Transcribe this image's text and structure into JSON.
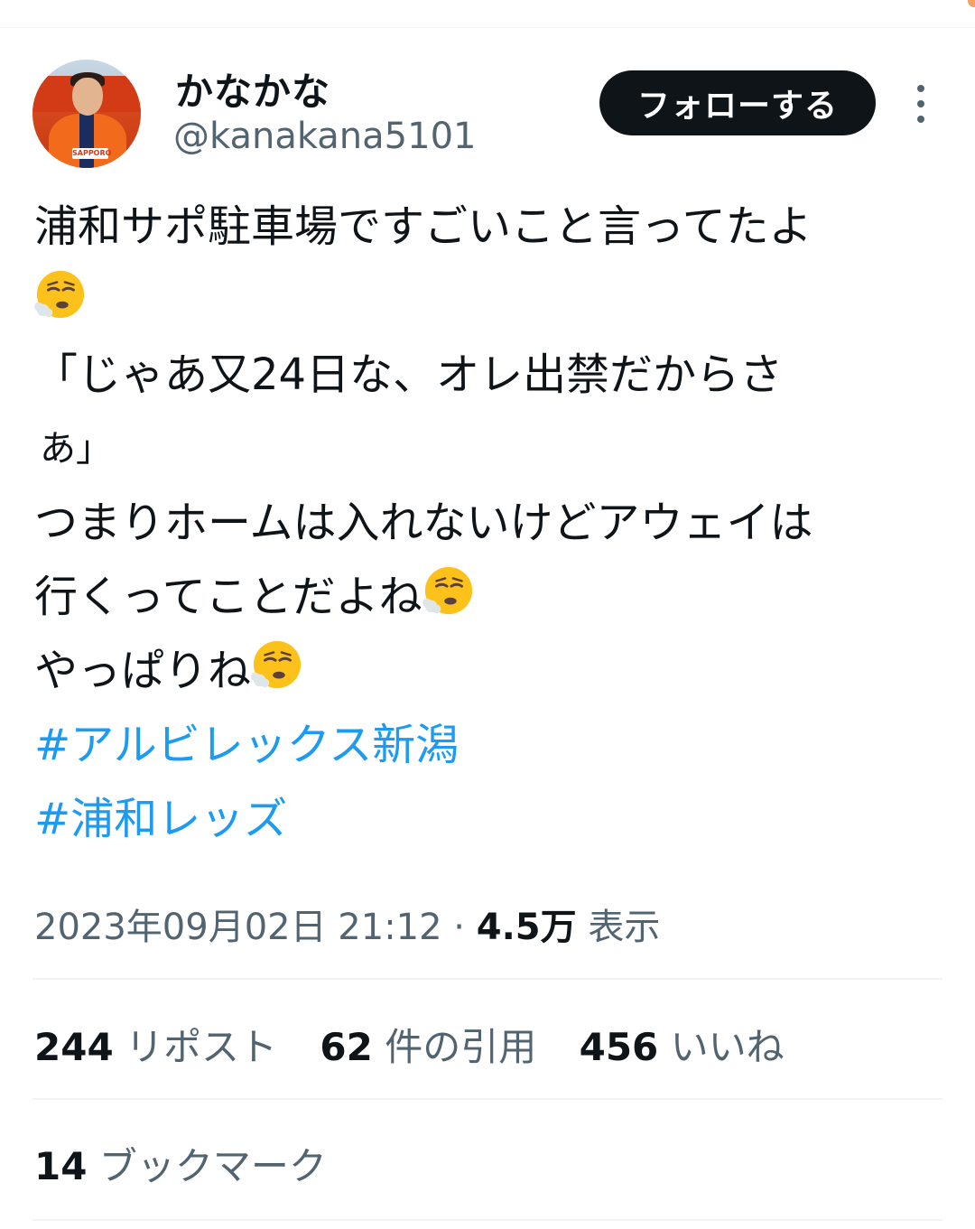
{
  "author": {
    "display_name": "かなかな",
    "handle": "@kanakana5101",
    "avatar_sponsor_text": "SAPPORO"
  },
  "follow_label": "フォローする",
  "tweet": {
    "line1": "浦和サポ駐車場ですごいこと言ってたよ",
    "line2": "「じゃあ又24日な、オレ出禁だからさ",
    "line3": "あ」",
    "line4": "つまりホームは入れないけどアウェイは",
    "line5": "行くってことだよね",
    "line6": "やっぱりね",
    "hashtag1": "#アルビレックス新潟",
    "hashtag2": "#浦和レッズ",
    "emoji_name": "face-exhaling-emoji"
  },
  "meta": {
    "timestamp": "2023年09月02日 21:12",
    "separator": " · ",
    "views": "4.5万",
    "views_label": "表示"
  },
  "stats": {
    "reposts": "244",
    "reposts_label": "リポスト",
    "quotes": "62",
    "quotes_label": "件の引用",
    "likes": "456",
    "likes_label": "いいね"
  },
  "bookmarks": {
    "count": "14",
    "label": "ブックマーク"
  },
  "colors": {
    "link": "#1d9bf0",
    "secondary_text": "#536471",
    "primary_text": "#0f1419",
    "follow_bg": "#0f1419"
  }
}
